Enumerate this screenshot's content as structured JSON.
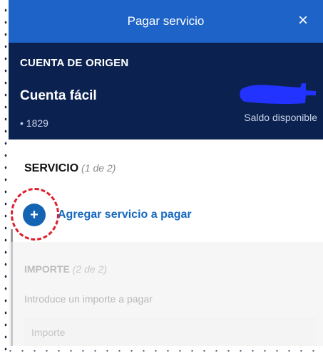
{
  "header": {
    "title": "Pagar servicio",
    "close_icon": "close-icon",
    "close_glyph": "×"
  },
  "account": {
    "section_label": "CUENTA DE ORIGEN",
    "name": "Cuenta fácil",
    "number": "• 1829",
    "balance_label": "Saldo disponible"
  },
  "service": {
    "heading": "SERVICIO",
    "step": "(1 de 2)",
    "add_icon": "plus-icon",
    "add_glyph": "+",
    "add_label": "Agregar servicio a pagar"
  },
  "importe": {
    "heading": "IMPORTE",
    "step": "(2 de 2)",
    "help_text": "Introduce un importe a pagar",
    "placeholder": "Importe"
  },
  "colors": {
    "header_blue": "#1e64c8",
    "card_navy": "#0b2150",
    "link_blue": "#1668c0",
    "highlight_red": "#e01e2d",
    "redaction_blue": "#2233ff"
  }
}
